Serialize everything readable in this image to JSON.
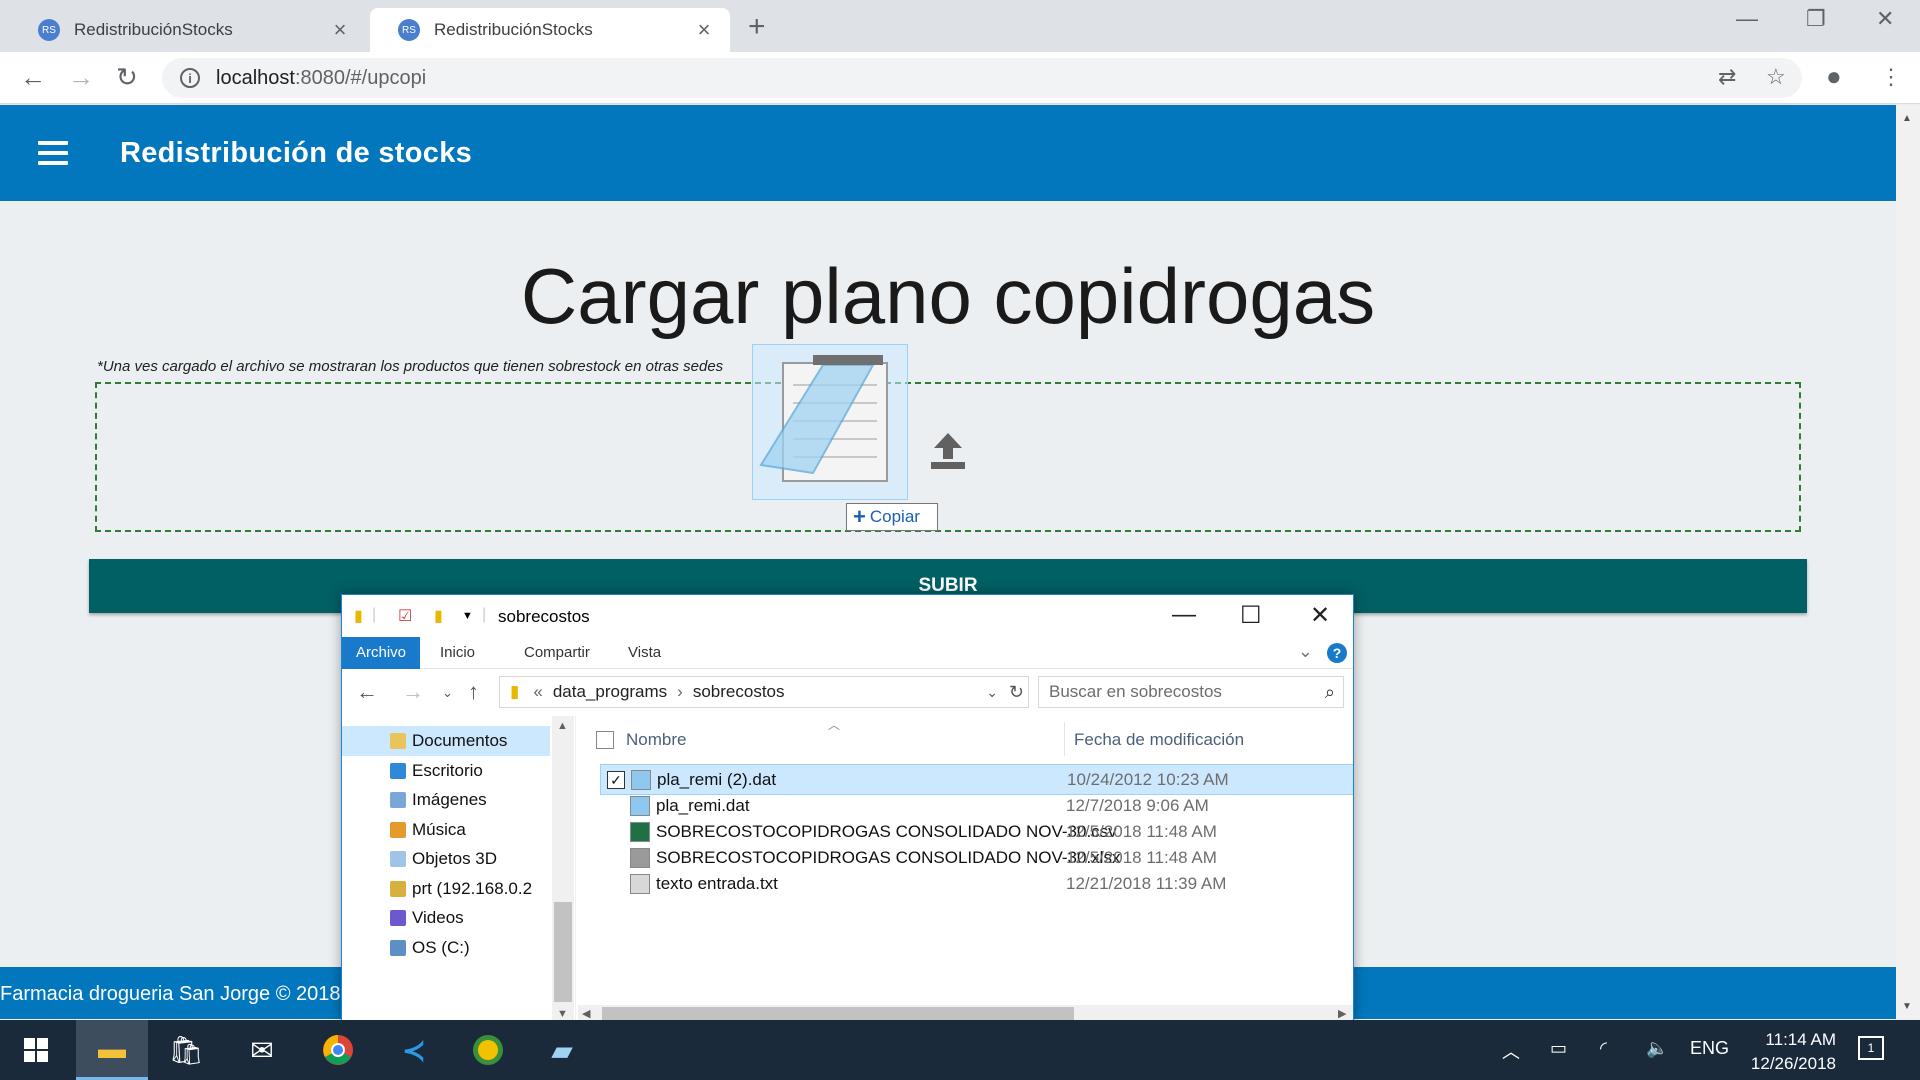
{
  "browser": {
    "tabs": [
      {
        "title": "RedistribuciónStocks",
        "active": false
      },
      {
        "title": "RedistribuciónStocks",
        "active": true
      }
    ],
    "new_tab_label": "+",
    "url_host": "localhost",
    "url_path": ":8080/#/upcopi"
  },
  "app": {
    "title": "Redistribución de stocks",
    "page_title": "Cargar plano copidrogas",
    "note": "*Una ves cargado el archivo se mostraran los productos que tienen sobrestock en otras sedes",
    "submit_label": "SUBIR",
    "drag_tooltip": "Copiar",
    "footer": "Farmacia drogueria San Jorge © 2018"
  },
  "explorer": {
    "window_title": "sobrecostos",
    "ribbon_tabs": [
      "Archivo",
      "Inicio",
      "Compartir",
      "Vista"
    ],
    "breadcrumb": [
      "data_programs",
      "sobrecostos"
    ],
    "breadcrumb_prefix": "«",
    "search_placeholder": "Buscar en sobrecostos",
    "nav_items": [
      {
        "label": "Documentos",
        "selected": true,
        "color": "#e8c45a"
      },
      {
        "label": "Escritorio",
        "selected": false,
        "color": "#2f88d8"
      },
      {
        "label": "Imágenes",
        "selected": false,
        "color": "#7aa7d8"
      },
      {
        "label": "Música",
        "selected": false,
        "color": "#e39b2e"
      },
      {
        "label": "Objetos 3D",
        "selected": false,
        "color": "#9fc4e8"
      },
      {
        "label": "prt (192.168.0.2",
        "selected": false,
        "color": "#d8b040"
      },
      {
        "label": "Videos",
        "selected": false,
        "color": "#6a5acd"
      },
      {
        "label": "OS (C:)",
        "selected": false,
        "color": "#5c8fc4"
      }
    ],
    "columns": {
      "name": "Nombre",
      "date": "Fecha de modificación"
    },
    "files": [
      {
        "name": "pla_remi (2).dat",
        "date": "10/24/2012 10:23 AM",
        "selected": true,
        "icon": "notepad-icon"
      },
      {
        "name": "pla_remi.dat",
        "date": "12/7/2018 9:06 AM",
        "selected": false,
        "icon": "notepad-icon"
      },
      {
        "name": "SOBRECOSTOCOPIDROGAS CONSOLIDADO NOV-30.csv",
        "date": "12/5/2018 11:48 AM",
        "selected": false,
        "icon": "excel-icon"
      },
      {
        "name": "SOBRECOSTOCOPIDROGAS CONSOLIDADO NOV-30.xlsx",
        "date": "12/5/2018 11:48 AM",
        "selected": false,
        "icon": "xlsx-file-icon"
      },
      {
        "name": "texto entrada.txt",
        "date": "12/21/2018 11:39 AM",
        "selected": false,
        "icon": "text-file-icon"
      }
    ]
  },
  "taskbar": {
    "language": "ENG",
    "time": "11:14 AM",
    "date": "12/26/2018",
    "notification_count": "1"
  }
}
